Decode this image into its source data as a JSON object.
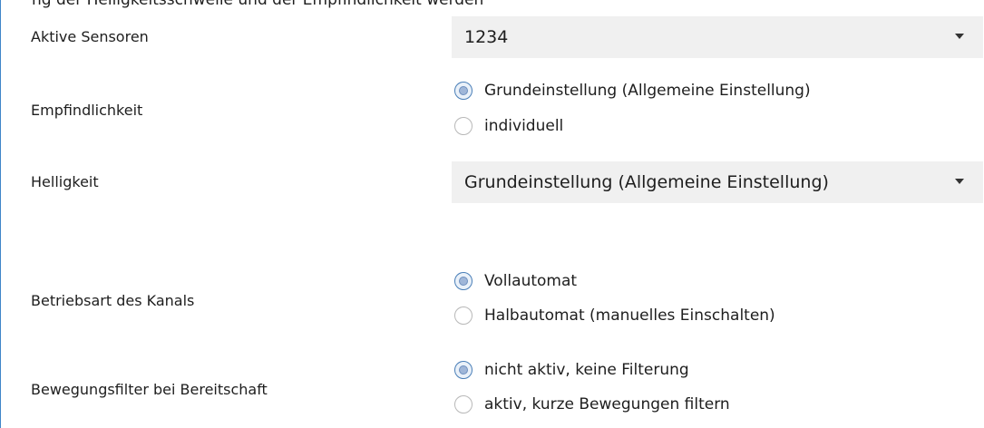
{
  "caption": "ng der Helligkeitsschwelle und der Empfindlichkeit werden",
  "rows": {
    "aktive_sensoren": {
      "label": "Aktive Sensoren",
      "value": "1234"
    },
    "empfindlichkeit": {
      "label": "Empfindlichkeit",
      "options": [
        "Grundeinstellung (Allgemeine Einstellung)",
        "individuell"
      ],
      "selected": 0
    },
    "helligkeit": {
      "label": "Helligkeit",
      "value": "Grundeinstellung (Allgemeine Einstellung)"
    },
    "betriebsart": {
      "label": "Betriebsart des Kanals",
      "options": [
        "Vollautomat",
        "Halbautomat (manuelles Einschalten)"
      ],
      "selected": 0
    },
    "bewegungsfilter": {
      "label": "Bewegungsfilter bei Bereitschaft",
      "options": [
        "nicht aktiv, keine Filterung",
        "aktiv, kurze Bewegungen filtern"
      ],
      "selected": 0
    }
  },
  "icons": {
    "dropdown": "chevron-down-icon",
    "radio_selected": "radio-selected-icon"
  }
}
